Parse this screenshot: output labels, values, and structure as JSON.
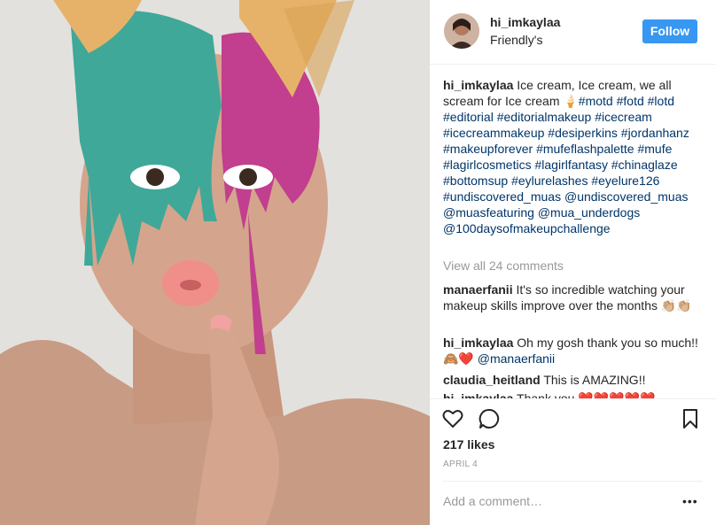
{
  "post": {
    "username": "hi_imkaylaa",
    "location": "Friendly's",
    "follow_label": "Follow"
  },
  "caption": {
    "username": "hi_imkaylaa",
    "text": "Ice cream, Ice cream, we all scream for Ice cream 🍦",
    "tags": [
      "#motd",
      "#fotd",
      "#lotd",
      "#editorial",
      "#editorialmakeup",
      "#icecream",
      "#icecreammakeup",
      "#desiperkins",
      "#jordanhanz",
      "#makeupforever",
      "#mufeflashpalette",
      "#mufe",
      "#lagirlcosmetics",
      "#lagirlfantasy",
      "#chinaglaze",
      "#bottomsup",
      "#eylurelashes",
      "#eyelure126",
      "#undiscovered_muas",
      "@undiscovered_muas",
      "@muasfeaturing",
      "@mua_underdogs",
      "@100daysofmakeupchallenge"
    ]
  },
  "view_all": "View all 24 comments",
  "comments": [
    {
      "user": "manaerfanii",
      "text": "It's so incredible watching your makeup skills improve over the months 👏🏼👏🏼"
    },
    {
      "user": "hi_imkaylaa",
      "text": "Oh my gosh thank you so much!!🙈❤️",
      "mention": "@manaerfanii"
    },
    {
      "user": "claudia_heitland",
      "text": "This is AMAZING!!"
    },
    {
      "user": "hi_imkaylaa",
      "text": "Thank you ❤️❤️❤️❤️❤️"
    }
  ],
  "likes": "217 likes",
  "date": "APRIL 4",
  "add_comment_placeholder": "Add a comment…",
  "more_label": "•••",
  "icons": [
    "heart-icon",
    "comment-icon",
    "bookmark-icon",
    "more-options-icon"
  ],
  "colors": {
    "follow_button": "#3897f0",
    "hashtag": "#003569",
    "muted": "#999999",
    "divider": "#efefef"
  }
}
